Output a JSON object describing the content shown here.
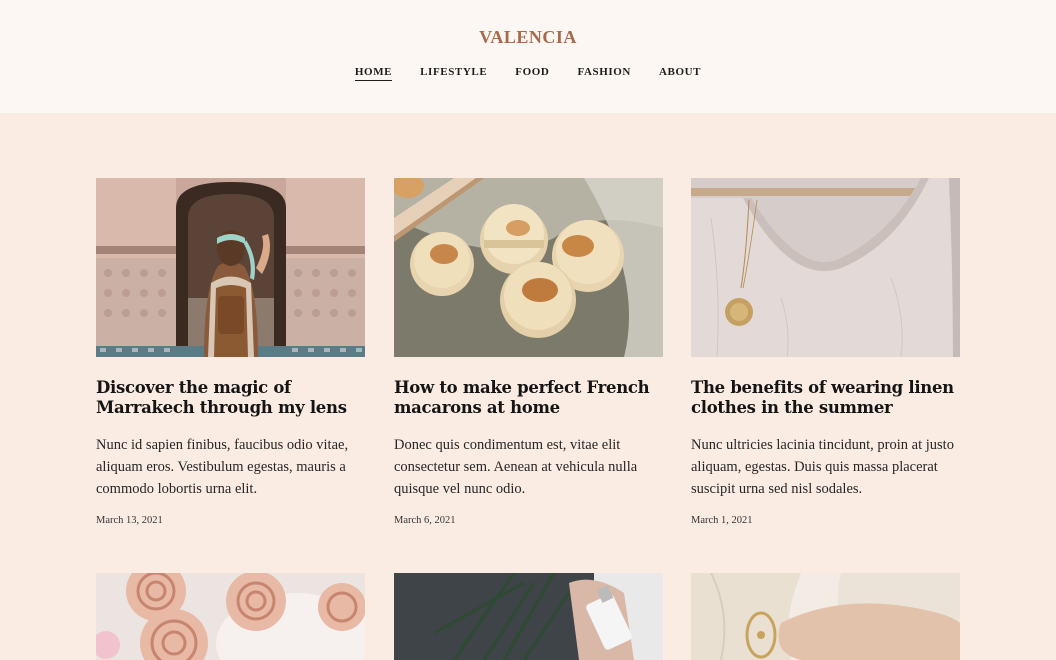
{
  "site": {
    "title": "VALENCIA"
  },
  "nav": {
    "items": [
      {
        "label": "HOME"
      },
      {
        "label": "LIFESTYLE"
      },
      {
        "label": "FOOD"
      },
      {
        "label": "FASHION"
      },
      {
        "label": "ABOUT"
      }
    ],
    "active": "HOME"
  },
  "posts": [
    {
      "title": "Discover the magic of Marrakech through my lens",
      "excerpt": "Nunc id sapien finibus, faucibus odio vitae, aliquam eros. Vestibulum egestas, mauris a commodo lobortis urna elit.",
      "date": "March 13, 2021"
    },
    {
      "title": "How to make perfect French macarons at home",
      "excerpt": "Donec quis condimentum est, vitae elit consectetur sem. Aenean at vehicula nulla quisque vel nunc odio.",
      "date": "March 6, 2021"
    },
    {
      "title": "The benefits of wearing linen clothes in the summer",
      "excerpt": "Nunc ultricies lacinia tincidunt, proin at justo aliquam, egestas. Duis quis massa placerat suscipit urna sed nisl sodales.",
      "date": "March 1, 2021"
    }
  ],
  "colors": {
    "page_background": "#fbece3",
    "header_background": "#fcf7f2",
    "brand": "#a86a4c"
  }
}
